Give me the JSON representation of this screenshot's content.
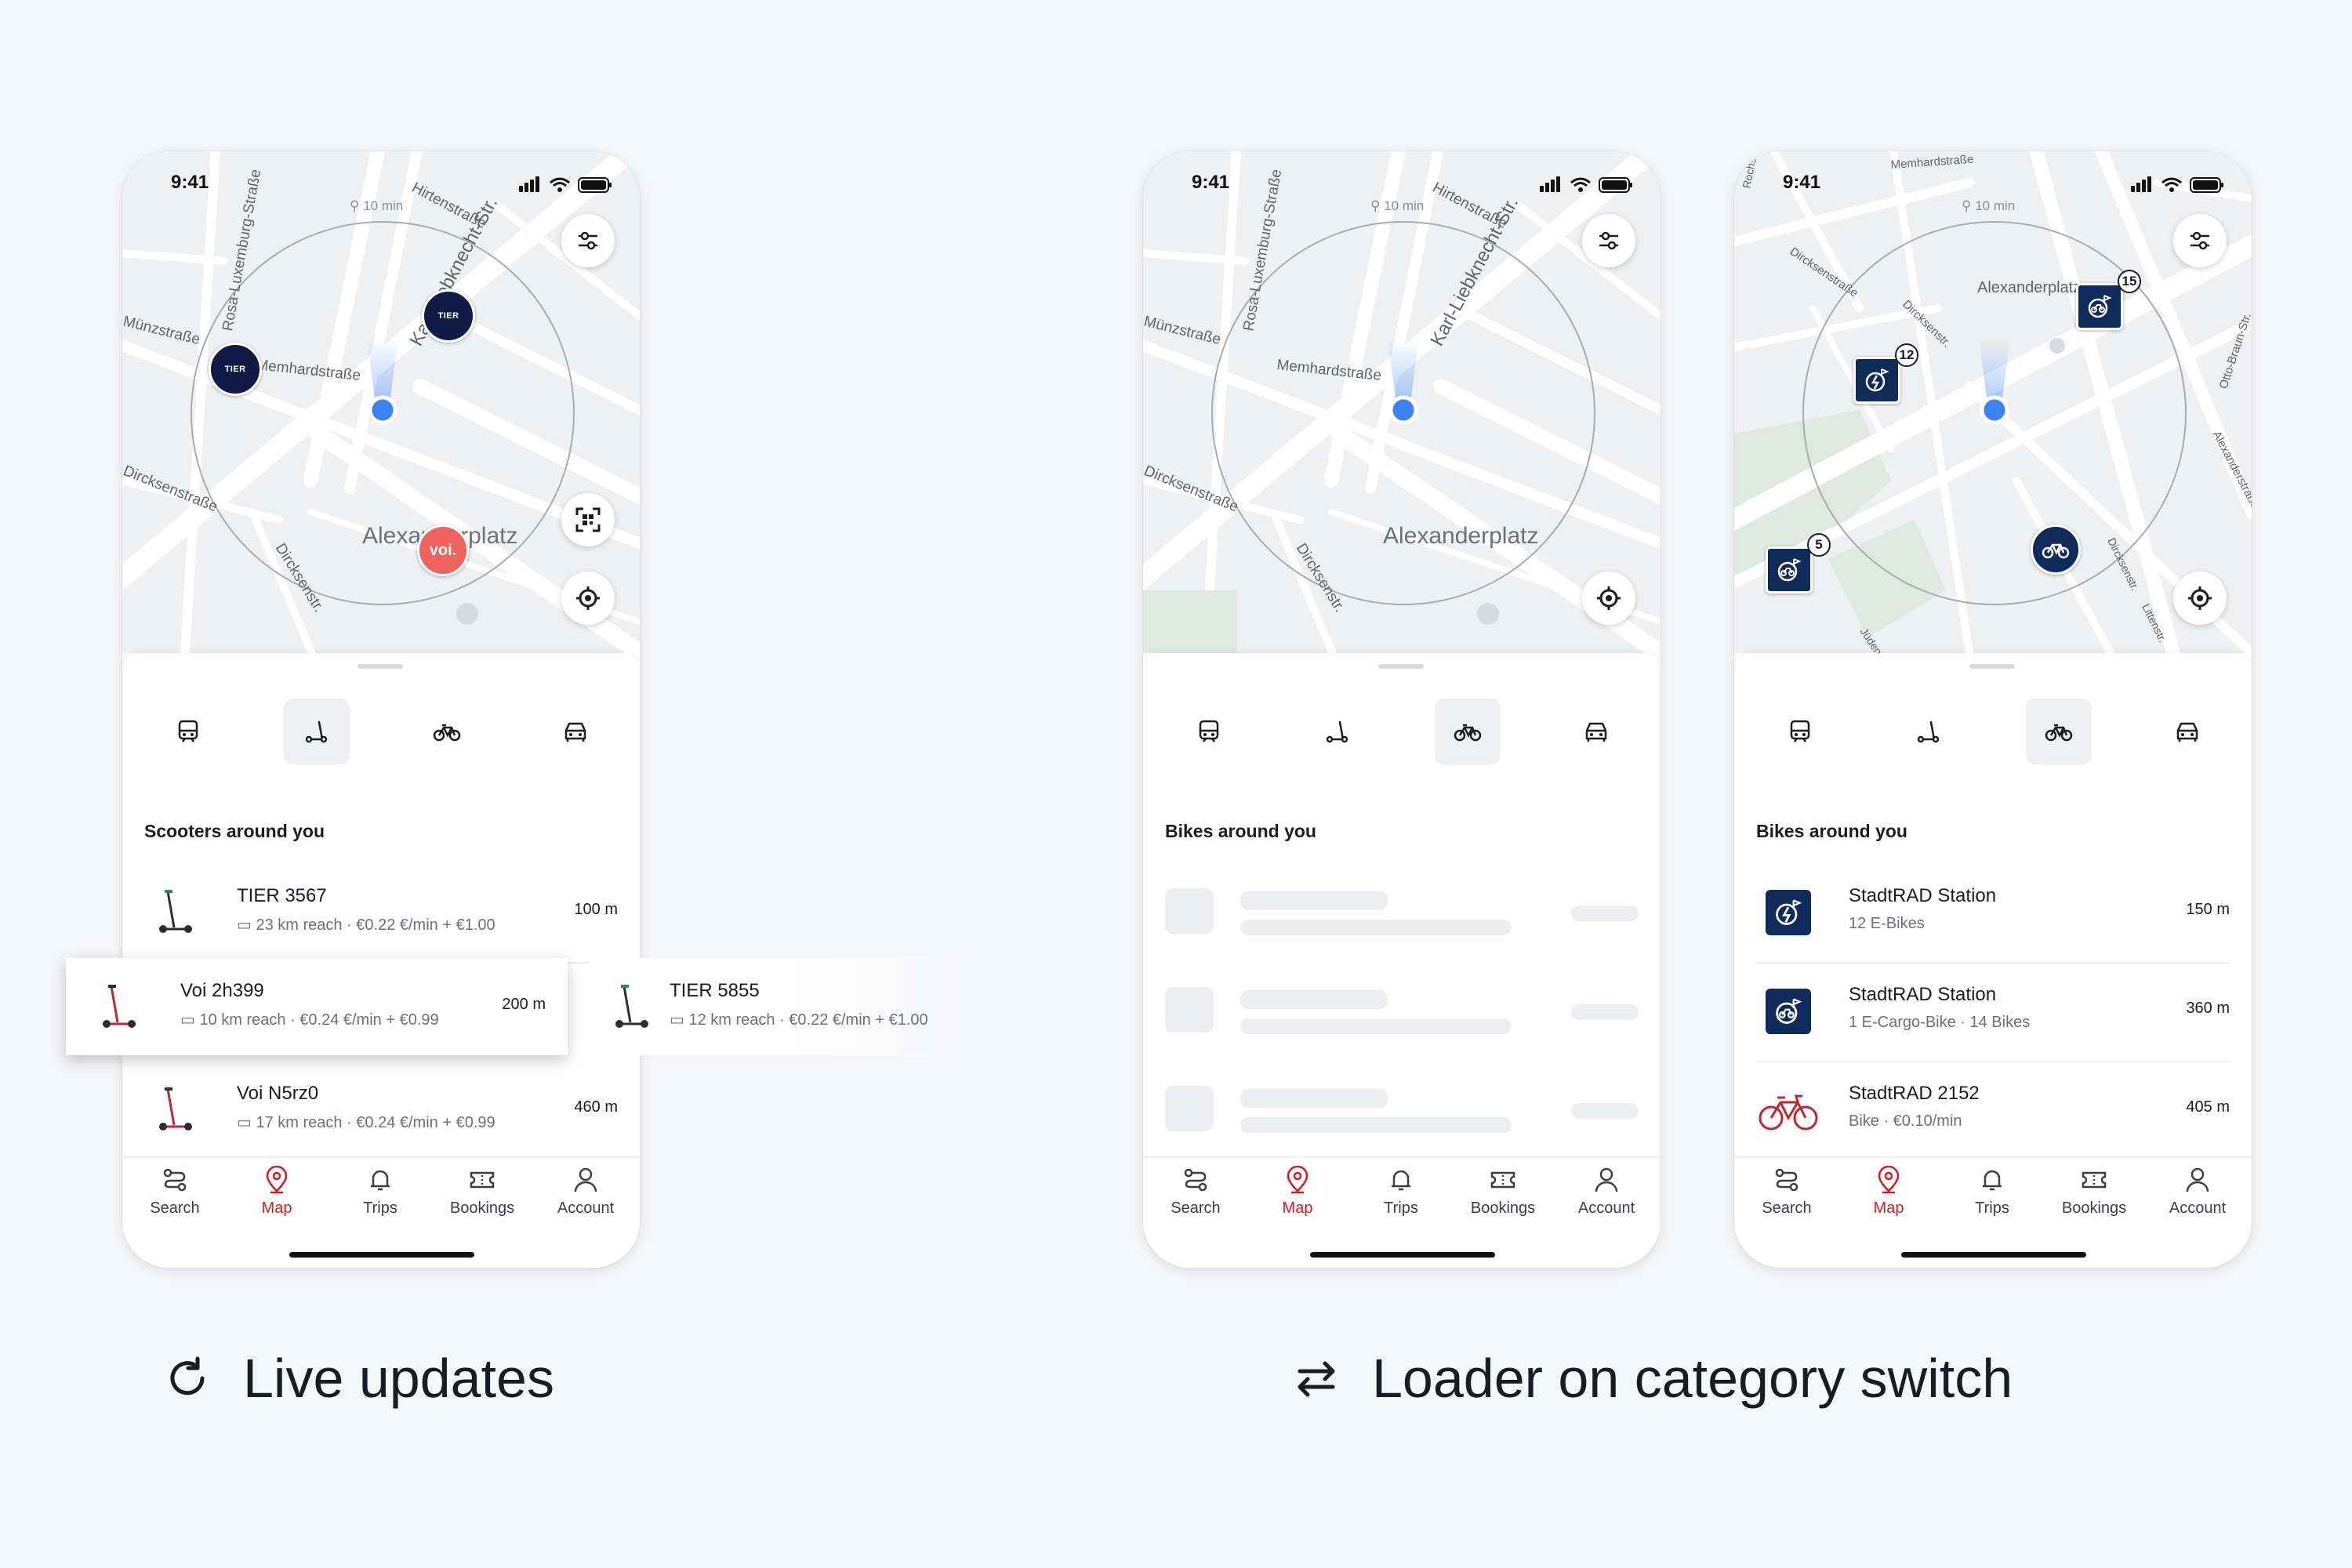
{
  "status": {
    "time": "9:41"
  },
  "map": {
    "walk_label": "10 min",
    "streets": {
      "rosa": "Rosa-Luxemburg-Straße",
      "hirten": "Hirtenstraße",
      "karl": "Karl-Liebknecht-Str.",
      "muenz": "Münzstraße",
      "memhard": "Memhardstraße",
      "dircksen": "Dircksenstraße",
      "dircksen_short": "Dircksenstr.",
      "alex": "Alexanderplatz",
      "otto": "Otto-Braun-Str.",
      "alexstr": "Alexanderstraße",
      "juden": "Jüden",
      "litten": "Littenstr.",
      "rochstr": "Rochstr."
    },
    "pins": {
      "tier": "TIER",
      "voi": "voi."
    },
    "station_counts": {
      "a": "12",
      "b": "15",
      "c": "5"
    }
  },
  "nav": {
    "search": "Search",
    "map": "Map",
    "trips": "Trips",
    "bookings": "Bookings",
    "account": "Account"
  },
  "phone1": {
    "title": "Scooters around you",
    "rows": [
      {
        "name": "TIER 3567",
        "sub": "23 km reach · €0.22 €/min + €1.00",
        "dist": "100 m"
      },
      {
        "name": "Voi 2h399",
        "sub": "10 km reach · €0.24 €/min + €0.99",
        "dist": "200 m"
      },
      {
        "name": "TIER 5855",
        "sub": "12 km reach · €0.22 €/min + €1.00",
        "dist": ""
      },
      {
        "name": "Voi N5rz0",
        "sub": "17 km reach · €0.24 €/min + €0.99",
        "dist": "460 m"
      }
    ]
  },
  "phone2": {
    "title": "Bikes around you"
  },
  "phone3": {
    "title": "Bikes around you",
    "rows": [
      {
        "name": "StadtRAD Station",
        "sub": "12 E-Bikes",
        "dist": "150 m"
      },
      {
        "name": "StadtRAD Station",
        "sub": "1 E-Cargo-Bike · 14 Bikes",
        "dist": "360 m"
      },
      {
        "name": "StadtRAD 2152",
        "sub": "Bike · €0.10/min",
        "dist": "405 m"
      }
    ]
  },
  "captions": {
    "live": "Live updates",
    "loader": "Loader on category switch"
  },
  "colors": {
    "accent": "#d7191f",
    "location": "#3b82f6",
    "navy": "#0f2b5c",
    "tier": "#0f1a45",
    "voi": "#f0625c"
  }
}
